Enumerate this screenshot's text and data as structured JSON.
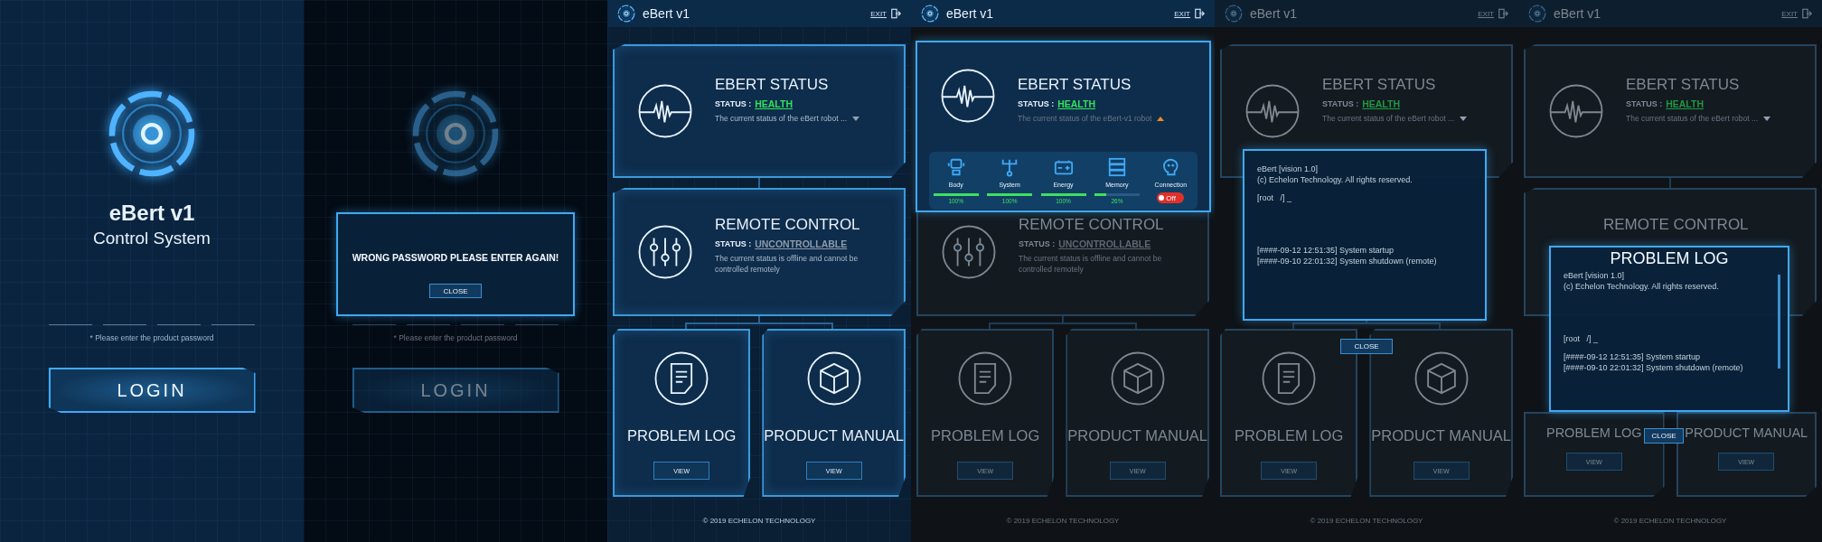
{
  "screens": [
    {
      "kind": "login",
      "dimmed": false,
      "title": "eBert v1",
      "subtitle": "Control System",
      "password_fields": [
        {
          "filled": false
        },
        {
          "filled": false
        },
        {
          "filled": false
        },
        {
          "filled": false
        }
      ],
      "hint": "* Please enter the product password",
      "login_button": "LOGIN"
    },
    {
      "kind": "login",
      "dimmed": true,
      "password_fields": [
        {
          "filled": false
        },
        {
          "filled": false
        },
        {
          "filled": false
        },
        {
          "filled": false
        }
      ],
      "hint": "* Please enter the product password",
      "login_button": "LOGIN",
      "dialog": {
        "kind": "alert",
        "message": "WRONG PASSWORD PLEASE ENTER AGAIN!",
        "close_button": "CLOSE"
      }
    },
    {
      "kind": "dashboard",
      "dimmed": false,
      "header": {
        "title": "eBert v1",
        "exit": "EXIT",
        "dimmed": false
      },
      "cards": [
        {
          "kind": "status",
          "title": "EBERT STATUS",
          "status_label": "STATUS :",
          "status": "HEALTH",
          "color": "#2fe35c",
          "description": "The current status of the eBert robot ...",
          "expanded": false
        },
        {
          "kind": "control",
          "title": "REMOTE CONTROL",
          "status_label": "STATUS :",
          "status": "UNCONTROLLABLE",
          "color": "#8d9bab",
          "description": "The current status is offline and cannot be controlled remotely"
        },
        {
          "kind": "log",
          "title": "PROBLEM LOG",
          "view_button": "VIEW"
        },
        {
          "kind": "manual",
          "title": "PRODUCT MANUAL",
          "view_button": "VIEW"
        }
      ],
      "footer": "© 2019 ECHELON TECHNOLOGY"
    },
    {
      "kind": "dashboard",
      "dimmed": true,
      "header": {
        "title": "eBert v1",
        "exit": "EXIT",
        "dimmed": false
      },
      "cards": [
        {
          "kind": "status"
        },
        {
          "kind": "control",
          "title": "REMOTE CONTROL",
          "status_label": "STATUS :",
          "status": "UNCONTROLLABLE",
          "color": "#5d6772",
          "description": "The current status is offline and cannot be controlled remotely"
        },
        {
          "kind": "log",
          "title": "PROBLEM LOG",
          "view_button": "VIEW"
        },
        {
          "kind": "manual",
          "title": "PRODUCT MANUAL",
          "view_button": "VIEW"
        }
      ],
      "footer": "© 2019 ECHELON TECHNOLOGY",
      "dialog": {
        "kind": "status_detail",
        "title": "EBERT STATUS",
        "status_label": "STATUS :",
        "status": "HEALTH",
        "color": "#2fe35c",
        "description": "The current status of the eBert-v1 robot",
        "expanded": true,
        "metrics": [
          {
            "kind": "meter",
            "label": "Body",
            "level": 1,
            "reading": "100%"
          },
          {
            "kind": "meter",
            "label": "System",
            "level": 1,
            "reading": "100%"
          },
          {
            "kind": "meter",
            "label": "Energy",
            "level": 1,
            "reading": "100%"
          },
          {
            "kind": "meter",
            "label": "Memory",
            "level": 0.26,
            "reading": "26%"
          },
          {
            "kind": "toggle",
            "label": "Connection",
            "on": false,
            "toggle_text": "Off"
          }
        ]
      }
    },
    {
      "kind": "dashboard",
      "dimmed": true,
      "header": {
        "title": "eBert v1",
        "exit": "EXIT",
        "dimmed": true
      },
      "cards": [
        {
          "kind": "status",
          "title": "EBERT STATUS",
          "status_label": "STATUS :",
          "status": "HEALTH",
          "color": "#1f9a42",
          "description": "The current status of the eBert robot ...",
          "expanded": false
        },
        {
          "kind": "control"
        },
        {
          "kind": "log",
          "title": "PROBLEM LOG",
          "view_button": "VIEW"
        },
        {
          "kind": "manual",
          "title": "PRODUCT MANUAL",
          "view_button": "VIEW"
        }
      ],
      "footer": "© 2019 ECHELON TECHNOLOGY",
      "dialog": {
        "kind": "log",
        "blocks": [
          [
            "eBert [vision 1.0]",
            "(c) Echelon Technology. All rights reserved."
          ],
          [
            "[root   /] _"
          ],
          [
            "[####-09-12 12:51:35] System startup",
            "[####-09-10 22:01:32] System shutdown (remote)"
          ]
        ],
        "close_button": "CLOSE"
      }
    },
    {
      "kind": "dashboard",
      "dimmed": true,
      "header": {
        "title": "eBert v1",
        "exit": "EXIT",
        "dimmed": true
      },
      "cards": [
        {
          "kind": "status",
          "title": "EBERT STATUS",
          "status_label": "STATUS :",
          "status": "HEALTH",
          "color": "#1f9a42",
          "description": "The current status of the eBert robot ...",
          "expanded": false
        },
        {
          "kind": "control",
          "title": "REMOTE CONTROL",
          "icon_covered": true
        },
        {
          "kind": "log",
          "title": "PROBLEM LOG",
          "view_button": "VIEW",
          "icon_covered": true
        },
        {
          "kind": "manual",
          "title": "PRODUCT MANUAL",
          "view_button": "VIEW",
          "icon_covered": true
        }
      ],
      "footer": "© 2019 ECHELON TECHNOLOGY",
      "dialog": {
        "kind": "log",
        "title": "PROBLEM LOG",
        "blocks": [
          [
            "eBert [vision 1.0]",
            "(c) Echelon Technology. All rights reserved."
          ],
          [
            "[root   /] _"
          ],
          [
            "[####-09-12 12:51:35] System startup",
            "[####-09-10 22:01:32] System shutdown (remote)"
          ]
        ],
        "close_button": "CLOSE"
      }
    }
  ]
}
